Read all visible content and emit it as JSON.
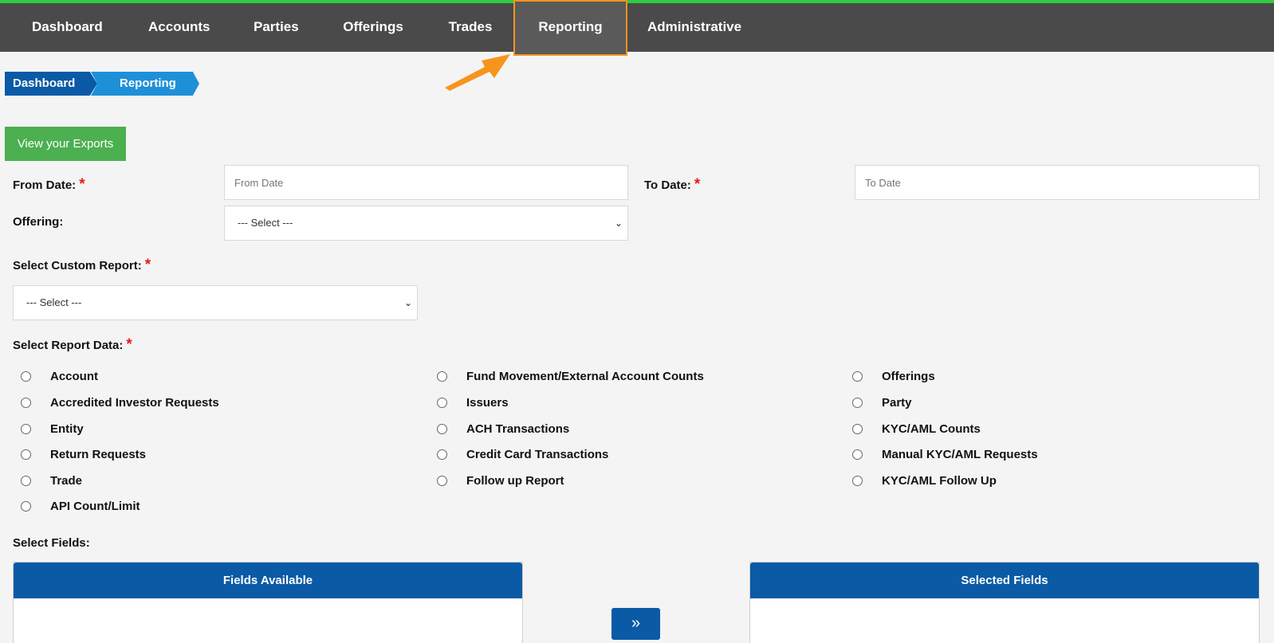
{
  "nav": {
    "items": [
      "Dashboard",
      "Accounts",
      "Parties",
      "Offerings",
      "Trades",
      "Reporting",
      "Administrative"
    ],
    "active": "Reporting"
  },
  "breadcrumb": [
    "Dashboard",
    "Reporting"
  ],
  "exports_button": "View your Exports",
  "form": {
    "from_date_label": "From Date:",
    "from_date_placeholder": "From Date",
    "to_date_label": "To Date:",
    "to_date_placeholder": "To Date",
    "offering_label": "Offering:",
    "offering_value": "--- Select ---",
    "custom_report_label": "Select Custom Report:",
    "custom_report_value": "--- Select ---",
    "report_data_label": "Select Report Data:",
    "required_mark": "*"
  },
  "report_data": {
    "col1": [
      "Account",
      "Accredited Investor Requests",
      "Entity",
      "Return Requests",
      "Trade",
      "API Count/Limit"
    ],
    "col2": [
      "Fund Movement/External Account Counts",
      "Issuers",
      "ACH Transactions",
      "Credit Card Transactions",
      "Follow up Report"
    ],
    "col3": [
      "Offerings",
      "Party",
      "KYC/AML Counts",
      "Manual KYC/AML Requests",
      "KYC/AML Follow Up"
    ]
  },
  "fields": {
    "label": "Select Fields:",
    "available_title": "Fields Available",
    "selected_title": "Selected Fields"
  },
  "colors": {
    "nav_bg": "#4a4a4a",
    "accent_green": "#2ecc40",
    "highlight_orange": "#f7941d",
    "primary_blue": "#0b5aa5",
    "button_green": "#4caf50"
  }
}
